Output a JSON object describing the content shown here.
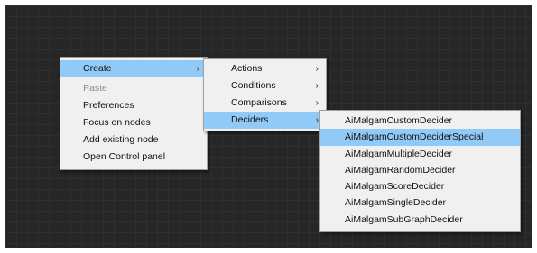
{
  "context_menu": {
    "items": [
      {
        "label": "Create",
        "arrow": "›",
        "highlighted": true
      },
      {
        "label": "Paste",
        "disabled": true
      },
      {
        "label": "Preferences"
      },
      {
        "label": "Focus on nodes"
      },
      {
        "label": "Add existing node"
      },
      {
        "label": "Open Control panel"
      }
    ]
  },
  "create_submenu": {
    "items": [
      {
        "label": "Actions",
        "arrow": "›"
      },
      {
        "label": "Conditions",
        "arrow": "›"
      },
      {
        "label": "Comparisons",
        "arrow": "›"
      },
      {
        "label": "Deciders",
        "arrow": "›",
        "highlighted": true
      }
    ]
  },
  "deciders_submenu": {
    "items": [
      {
        "label": "AiMalgamCustomDecider"
      },
      {
        "label": "AiMalgamCustomDeciderSpecial",
        "highlighted": true
      },
      {
        "label": "AiMalgamMultipleDecider"
      },
      {
        "label": "AiMalgamRandomDecider"
      },
      {
        "label": "AiMalgamScoreDecider"
      },
      {
        "label": "AiMalgamSingleDecider"
      },
      {
        "label": "AiMalgamSubGraphDecider"
      }
    ]
  },
  "colors": {
    "canvas_background": "#262626",
    "grid_line": "#2f2f2f",
    "menu_background": "#f0f0f0",
    "highlight": "#91c9f7",
    "disabled_text": "#8a8a8a"
  }
}
